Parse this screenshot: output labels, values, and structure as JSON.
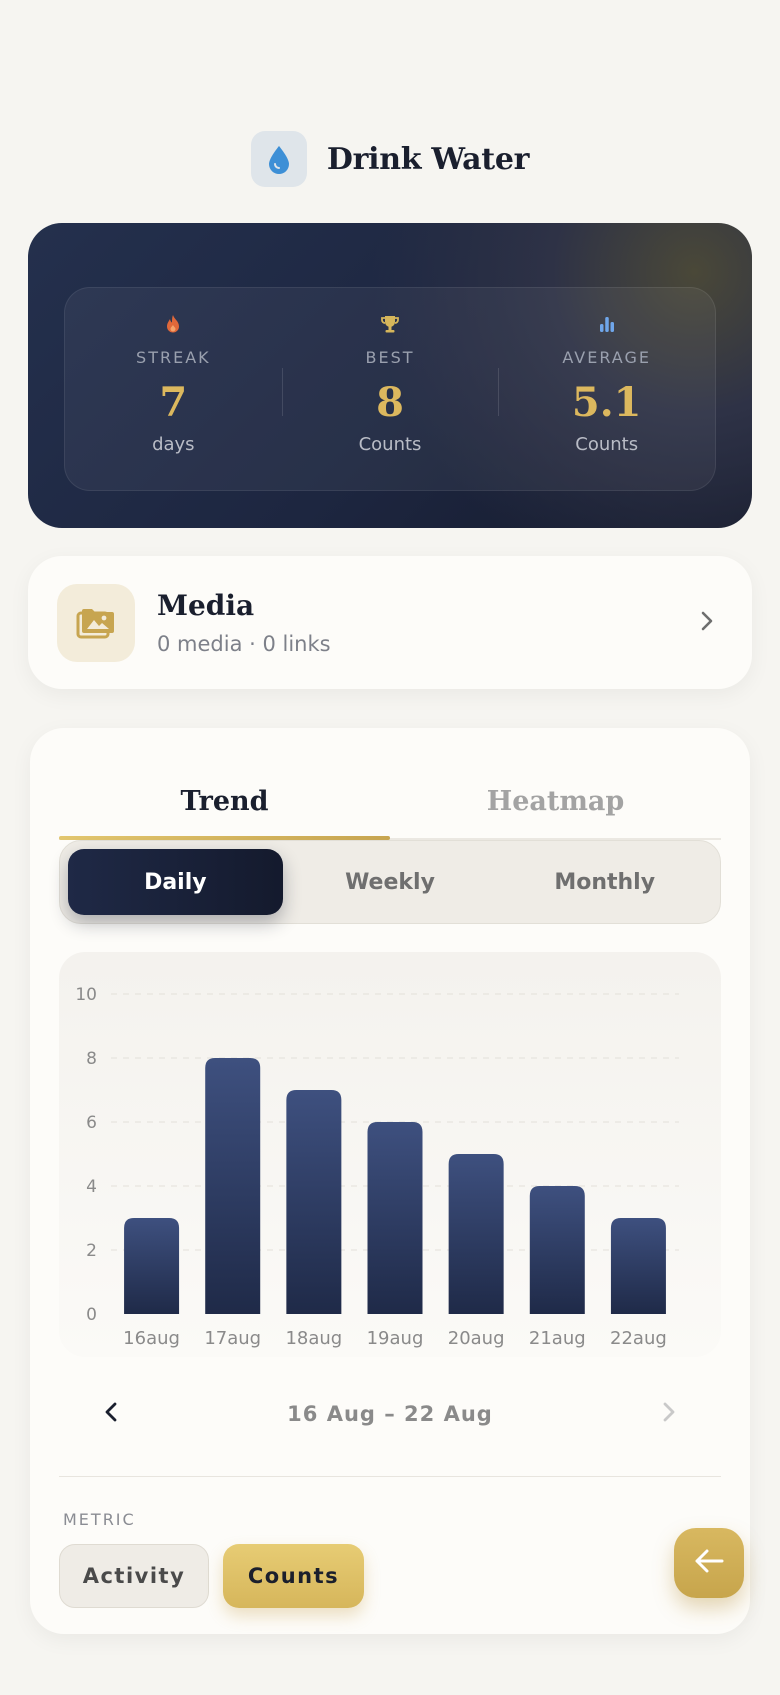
{
  "header": {
    "title": "Drink Water",
    "icon": "water-drop-icon"
  },
  "stats": [
    {
      "icon": "flame-icon",
      "label": "STREAK",
      "value": "7",
      "unit": "days"
    },
    {
      "icon": "trophy-icon",
      "label": "BEST",
      "value": "8",
      "unit": "Counts"
    },
    {
      "icon": "bar-chart-icon",
      "label": "AVERAGE",
      "value": "5.1",
      "unit": "Counts"
    }
  ],
  "media": {
    "title": "Media",
    "subtitle": "0 media · 0 links",
    "icon": "photo-folder-icon"
  },
  "tabs": [
    {
      "label": "Trend",
      "active": true
    },
    {
      "label": "Heatmap",
      "active": false
    }
  ],
  "periods": [
    {
      "label": "Daily",
      "active": true
    },
    {
      "label": "Weekly",
      "active": false
    },
    {
      "label": "Monthly",
      "active": false
    }
  ],
  "chart_data": {
    "type": "bar",
    "categories": [
      "16aug",
      "17aug",
      "18aug",
      "19aug",
      "20aug",
      "21aug",
      "22aug"
    ],
    "values": [
      3,
      8,
      7,
      6,
      5,
      4,
      3
    ],
    "ylim": [
      0,
      10
    ],
    "yticks": [
      0,
      2,
      4,
      6,
      8,
      10
    ],
    "grid": true
  },
  "range": {
    "label": "16 Aug – 22 Aug"
  },
  "metric": {
    "label": "METRIC",
    "options": [
      {
        "label": "Activity",
        "active": false
      },
      {
        "label": "Counts",
        "active": true
      }
    ]
  },
  "colors": {
    "accent_gold": "#d6b65b",
    "navy": "#1d2640",
    "bar": "#2f3d63"
  }
}
